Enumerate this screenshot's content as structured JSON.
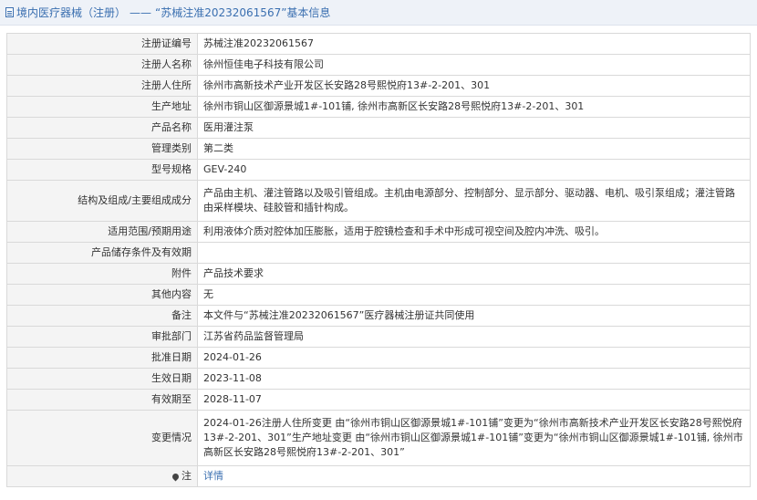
{
  "header": {
    "breadcrumb": "境内医疗器械（注册）",
    "separator": "——",
    "title": "“苏械注准20232061567”基本信息"
  },
  "rows": [
    {
      "label": "注册证编号",
      "value": "苏械注准20232061567"
    },
    {
      "label": "注册人名称",
      "value": "徐州恒佳电子科技有限公司"
    },
    {
      "label": "注册人住所",
      "value": "徐州市高新技术产业开发区长安路28号熙悦府13#-2-201、301"
    },
    {
      "label": "生产地址",
      "value": "徐州市铜山区御源景城1#-101铺, 徐州市高新区长安路28号熙悦府13#-2-201、301"
    },
    {
      "label": "产品名称",
      "value": "医用灌注泵"
    },
    {
      "label": "管理类别",
      "value": "第二类"
    },
    {
      "label": "型号规格",
      "value": "GEV-240"
    },
    {
      "label": "结构及组成/主要组成成分",
      "value": "产品由主机、灌注管路以及吸引管组成。主机由电源部分、控制部分、显示部分、驱动器、电机、吸引泵组成；灌注管路由采样模块、硅胶管和插针构成。"
    },
    {
      "label": "适用范围/预期用途",
      "value": "利用液体介质对腔体加压膨胀，适用于腔镜检查和手术中形成可视空间及腔内冲洗、吸引。"
    },
    {
      "label": "产品储存条件及有效期",
      "value": ""
    },
    {
      "label": "附件",
      "value": "产品技术要求"
    },
    {
      "label": "其他内容",
      "value": "无"
    },
    {
      "label": "备注",
      "value": "本文件与“苏械注准20232061567”医疗器械注册证共同使用"
    },
    {
      "label": "审批部门",
      "value": "江苏省药品监督管理局"
    },
    {
      "label": "批准日期",
      "value": "2024-01-26"
    },
    {
      "label": "生效日期",
      "value": "2023-11-08"
    },
    {
      "label": "有效期至",
      "value": "2028-11-07"
    },
    {
      "label": "变更情况",
      "value": "2024-01-26注册人住所变更 由“徐州市铜山区御源景城1#-101铺”变更为“徐州市高新技术产业开发区长安路28号熙悦府13#-2-201、301”生产地址变更 由“徐州市铜山区御源景城1#-101铺”变更为“徐州市铜山区御源景城1#-101铺, 徐州市高新区长安路28号熙悦府13#-2-201、301”"
    }
  ],
  "note": {
    "label": "注",
    "link": "详情"
  }
}
